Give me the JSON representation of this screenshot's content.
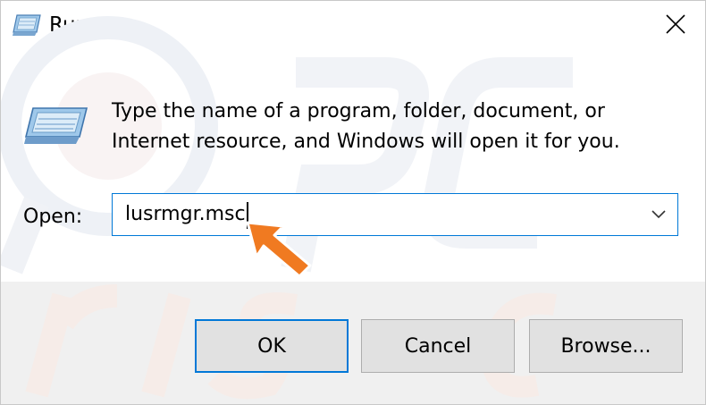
{
  "window": {
    "title": "Run",
    "close_icon": "close-icon"
  },
  "content": {
    "description": "Type the name of a program, folder, document, or Internet resource, and Windows will open it for you.",
    "open_label": "Open:",
    "open_value": "lusrmgr.msc"
  },
  "buttons": {
    "ok": "OK",
    "cancel": "Cancel",
    "browse": "Browse..."
  },
  "colors": {
    "accent": "#0078d7",
    "annotation_arrow": "#f07a21",
    "footer_bg": "#f0f0f0"
  }
}
